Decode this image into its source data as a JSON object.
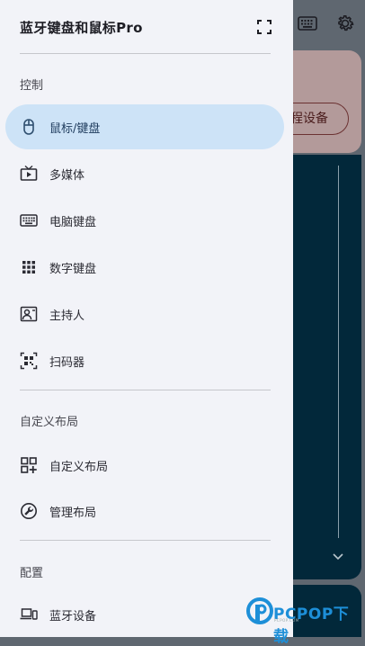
{
  "drawer": {
    "title": "蓝牙键盘和鼠标Pro",
    "sections": [
      {
        "label": "控制",
        "items": [
          {
            "label": "鼠标/键盘",
            "icon": "mouse-icon",
            "active": true
          },
          {
            "label": "多媒体",
            "icon": "tv-play-icon",
            "active": false
          },
          {
            "label": "电脑键盘",
            "icon": "keyboard-icon",
            "active": false
          },
          {
            "label": "数字键盘",
            "icon": "numpad-grid-icon",
            "active": false
          },
          {
            "label": "主持人",
            "icon": "presenter-icon",
            "active": false
          },
          {
            "label": "扫码器",
            "icon": "qr-scanner-icon",
            "active": false
          }
        ]
      },
      {
        "label": "自定义布局",
        "items": [
          {
            "label": "自定义布局",
            "icon": "grid-add-icon",
            "active": false
          },
          {
            "label": "管理布局",
            "icon": "wrench-circle-icon",
            "active": false
          }
        ]
      },
      {
        "label": "配置",
        "items": [
          {
            "label": "蓝牙设备",
            "icon": "laptop-phone-icon",
            "active": false
          }
        ]
      }
    ]
  },
  "background": {
    "connect_button_label": "程设备"
  },
  "watermark": {
    "text": "PCPOP下载",
    "small": "PCPOP.COM"
  },
  "colors": {
    "drawer_bg": "#f2f3f8",
    "active_item_bg": "#cde3f7",
    "dim_overlay": "#5f6770",
    "dark_panel": "#02283a",
    "watermark_blue": "#1d8fd8"
  }
}
